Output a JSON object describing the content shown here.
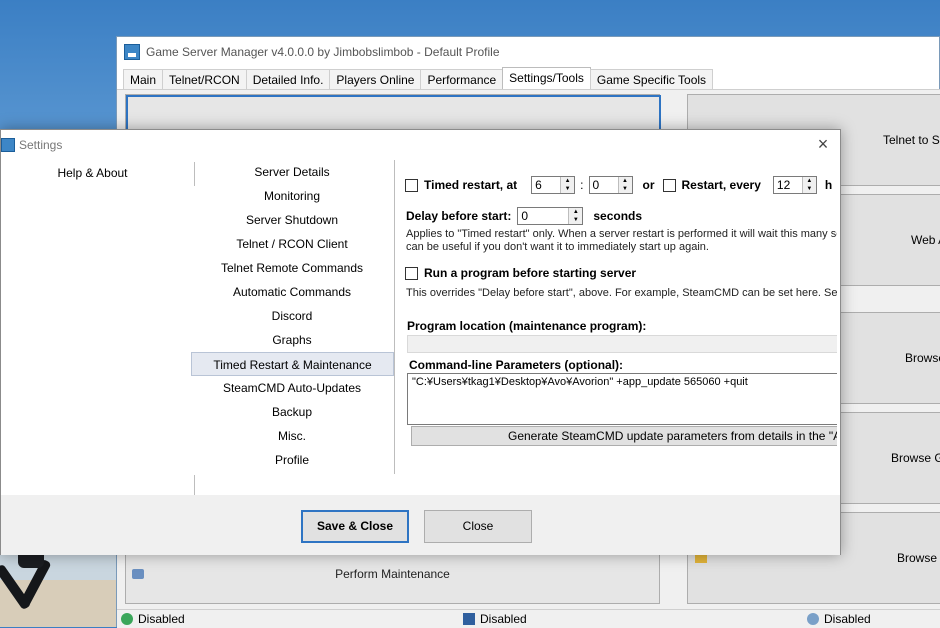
{
  "main_window": {
    "title": "Game Server Manager v4.0.0.0 by Jimbobslimbob - Default Profile",
    "tabs": [
      "Main",
      "Telnet/RCON",
      "Detailed Info.",
      "Players Online",
      "Performance",
      "Settings/Tools",
      "Game Specific Tools"
    ],
    "active_tab": "Settings/Tools",
    "perform_maintenance": "Perform Maintenance",
    "right_buttons": [
      "Telnet to Se",
      "Web A",
      "Browse",
      "Browse Ga",
      "Browse E"
    ],
    "status": [
      "Disabled",
      "Disabled",
      "Disabled"
    ]
  },
  "dialog": {
    "title": "Settings",
    "help_about": "Help & About",
    "nav": [
      "Server Details",
      "Monitoring",
      "Server Shutdown",
      "Telnet / RCON Client",
      "Telnet Remote Commands",
      "Automatic Commands",
      "Discord",
      "Graphs",
      "Timed Restart & Maintenance",
      "SteamCMD Auto-Updates",
      "Backup",
      "Misc.",
      "Profile"
    ],
    "selected_nav": "Timed Restart & Maintenance",
    "timed_restart_label": "Timed restart, at",
    "hour": "6",
    "colon": ":",
    "minute": "0",
    "or": "or",
    "restart_every_label": "Restart, every",
    "every_value": "12",
    "every_unit": "h",
    "delay_label": "Delay before start:",
    "delay_value": "0",
    "seconds": "seconds",
    "delay_desc_1": "Applies to \"Timed restart\" only. When a server restart is performed it will wait this many secor",
    "delay_desc_2": "can be useful if you don't want it to immediately start up again.",
    "run_program_label": "Run a program before starting server",
    "run_program_desc": "This overrides \"Delay before start\", above. For example, SteamCMD can be set here. Settin",
    "program_location_label": "Program location (maintenance program):",
    "program_location_value": "",
    "cmdline_label": "Command-line Parameters (optional):",
    "cmdline_value": "\"C:¥Users¥tkag1¥Desktop¥Avo¥Avorion\" +app_update 565060 +quit",
    "generate_button": "Generate SteamCMD update parameters from details in the \"Au",
    "save_close": "Save & Close",
    "close": "Close"
  },
  "colors": {
    "accent": "#2e74c3",
    "nav_selected": "#e5e9f1",
    "dialog_bottom": "#f0f0f0"
  }
}
